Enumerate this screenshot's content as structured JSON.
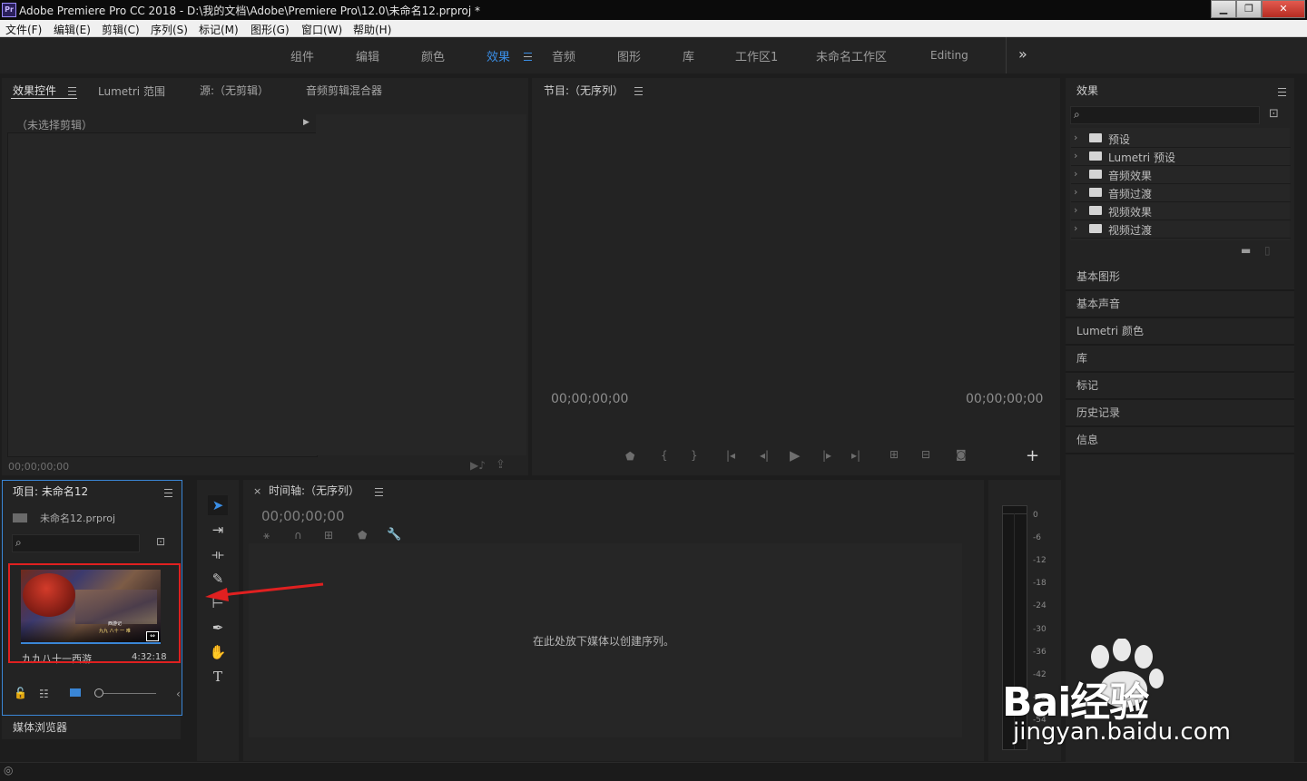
{
  "window": {
    "app_icon": "Pr",
    "title": "Adobe Premiere Pro CC 2018 - D:\\我的文档\\Adobe\\Premiere Pro\\12.0\\未命名12.prproj *",
    "minimize": "▁",
    "maximize": "❐",
    "close": "✕"
  },
  "menu": [
    "文件(F)",
    "编辑(E)",
    "剪辑(C)",
    "序列(S)",
    "标记(M)",
    "图形(G)",
    "窗口(W)",
    "帮助(H)"
  ],
  "workspaces": {
    "tabs": [
      "组件",
      "编辑",
      "颜色",
      "效果",
      "音频",
      "图形",
      "库",
      "工作区1",
      "未命名工作区",
      "Editing"
    ],
    "active": "效果",
    "overflow": "»",
    "active_color": "#3a8ee6"
  },
  "source_panel": {
    "tabs": [
      "效果控件",
      "Lumetri 范围",
      "源:（无剪辑）",
      "音频剪辑混合器"
    ],
    "no_clip": "（未选择剪辑）",
    "timecode": "00;00;00;00"
  },
  "program_panel": {
    "title": "节目:（无序列）",
    "timecode_left": "00;00;00;00",
    "timecode_right": "00;00;00;00",
    "add_button": "+"
  },
  "effects_panel": {
    "title": "效果",
    "folders": [
      "预设",
      "Lumetri 预设",
      "音频效果",
      "音频过渡",
      "视频效果",
      "视频过渡"
    ],
    "collapsed_panels": [
      "基本图形",
      "基本声音",
      "Lumetri 颜色",
      "库",
      "标记",
      "历史记录",
      "信息"
    ]
  },
  "project_panel": {
    "title": "项目: 未命名12",
    "file": "未命名12.prproj",
    "clip": {
      "name": "九九八十一西游",
      "duration": "4:32:18",
      "caption_line1": "西游记",
      "caption_line2": "九九 八十 一 难"
    },
    "media_browser": "媒体浏览器"
  },
  "timeline_panel": {
    "title": "时间轴:（无序列）",
    "close": "×",
    "timecode": "00;00;00;00",
    "drop_hint": "在此处放下媒体以创建序列。"
  },
  "audio_meter": {
    "ticks": [
      "0",
      "-6",
      "-12",
      "-18",
      "-24",
      "-30",
      "-36",
      "-42",
      "-48",
      "-54"
    ]
  },
  "watermark": {
    "brand": "Bai经验",
    "url": "jingyan.baidu.com"
  },
  "annotation_color": "#e02020"
}
